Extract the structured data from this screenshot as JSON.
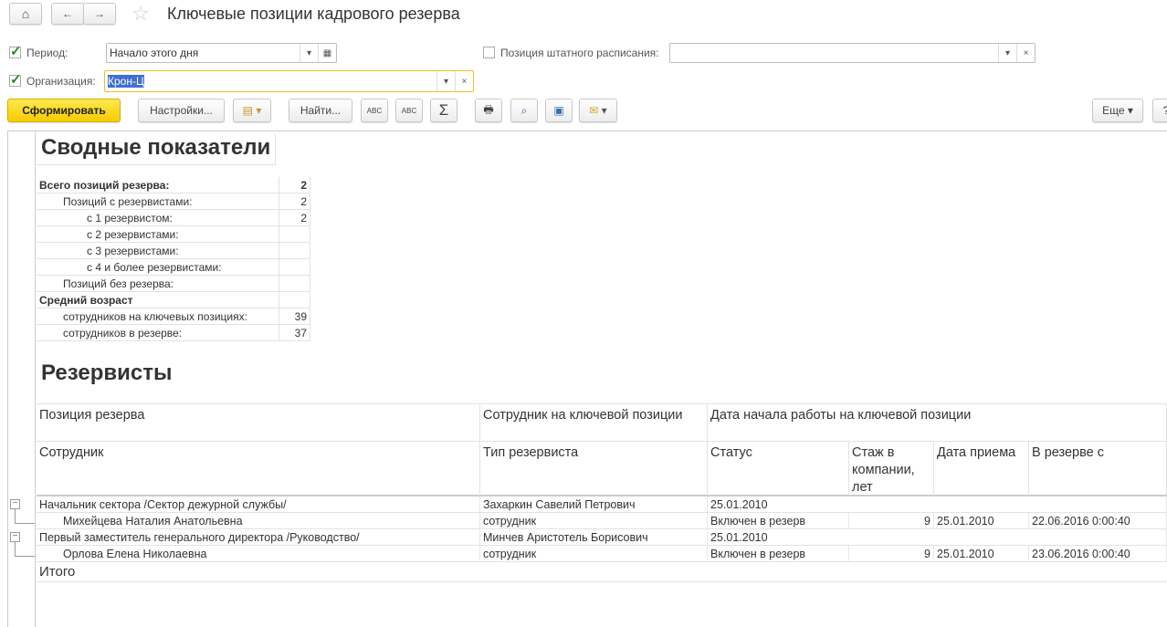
{
  "window": {
    "title": "Ключевые позиции кадрового резерва"
  },
  "filters": {
    "period": {
      "label": "Период:",
      "value": "Начало этого дня",
      "checked": true
    },
    "organization": {
      "label": "Организация:",
      "value": "Крон-Ц",
      "checked": true
    },
    "position": {
      "label": "Позиция штатного расписания:",
      "value": "",
      "checked": false
    }
  },
  "toolbar": {
    "generate": "Сформировать",
    "settings": "Настройки...",
    "find": "Найти...",
    "more": "Еще",
    "help": "?"
  },
  "summary": {
    "title": "Сводные показатели",
    "rows": [
      {
        "label": "Всего позиций резерва:",
        "value": "2"
      },
      {
        "label": "Позиций с резервистами:",
        "value": "2"
      },
      {
        "label": "с 1 резервистом:",
        "value": "2"
      },
      {
        "label": "с 2 резервистами:",
        "value": ""
      },
      {
        "label": "с 3 резервистами:",
        "value": ""
      },
      {
        "label": "с 4 и более резервистами:",
        "value": ""
      },
      {
        "label": "Позиций без резерва:",
        "value": ""
      },
      {
        "label": "Средний возраст",
        "value": ""
      },
      {
        "label": "сотрудников на ключевых позициях:",
        "value": "39"
      },
      {
        "label": "сотрудников в резерве:",
        "value": "37"
      }
    ]
  },
  "reservists": {
    "title": "Резервисты",
    "header1": [
      "Позиция резерва",
      "Сотрудник на ключевой позиции",
      "Дата начала работы на ключевой позиции"
    ],
    "header2": [
      "Сотрудник",
      "Тип резервиста",
      "Статус",
      "Стаж в компании, лет",
      "Дата приема",
      "В резерве с"
    ],
    "groups": [
      {
        "position": "Начальник сектора /Сектор дежурной службы/",
        "key_employee": "Захаркин Савелий Петрович",
        "start": "25.01.2010",
        "row": [
          "Михейцева Наталия Анатольевна",
          "сотрудник",
          "Включен в резерв",
          "9",
          "25.01.2010",
          "22.06.2016 0:00:40"
        ]
      },
      {
        "position": "Первый заместитель генерального директора /Руководство/",
        "key_employee": "Минчев Аристотель Борисович",
        "start": "25.01.2010",
        "row": [
          "Орлова Елена Николаевна",
          "сотрудник",
          "Включен в резерв",
          "9",
          "25.01.2010",
          "23.06.2016 0:00:40"
        ]
      }
    ],
    "total": "Итого"
  }
}
